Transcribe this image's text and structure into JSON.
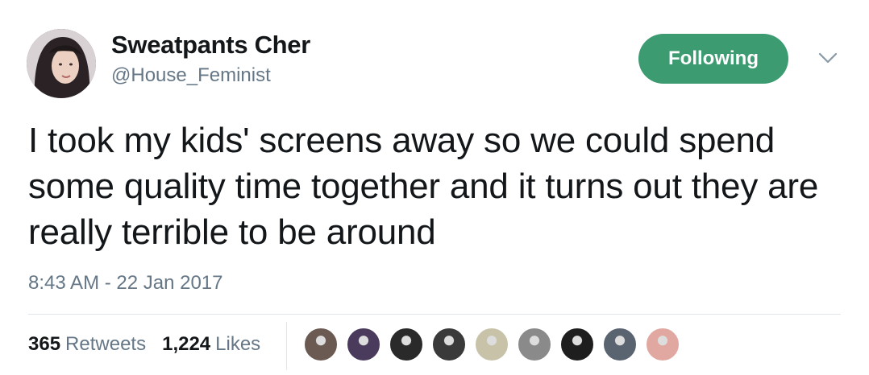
{
  "author": {
    "display_name": "Sweatpants Cher",
    "handle": "@House_Feminist",
    "avatar_icon": "profile-photo"
  },
  "follow_button": {
    "label": "Following",
    "color": "#3d9b71"
  },
  "menu_icon": "chevron-down-icon",
  "tweet": {
    "text": "I took my kids' screens away so we could spend some quality time together and it turns out they are really terrible to be around",
    "timestamp": "8:43 AM - 22 Jan 2017"
  },
  "stats": {
    "retweets_count": "365",
    "retweets_label": "Retweets",
    "likes_count": "1,224",
    "likes_label": "Likes"
  },
  "likers": [
    {
      "color": "#6b5a52"
    },
    {
      "color": "#4a3a5c"
    },
    {
      "color": "#2a2a2a"
    },
    {
      "color": "#3a3a3a"
    },
    {
      "color": "#c7c2a8"
    },
    {
      "color": "#8a8a8a"
    },
    {
      "color": "#1e1e1e"
    },
    {
      "color": "#5a6470"
    },
    {
      "color": "#e0a8a0"
    }
  ]
}
